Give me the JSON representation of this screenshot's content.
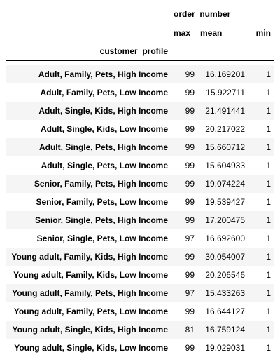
{
  "table": {
    "column_group": "order_number",
    "columns": [
      "max",
      "mean",
      "min"
    ],
    "index_name": "customer_profile",
    "rows": [
      {
        "label": "Adult, Family, Pets, High Income",
        "max": "99",
        "mean": "16.169201",
        "min": "1"
      },
      {
        "label": "Adult, Family, Pets, Low Income",
        "max": "99",
        "mean": "15.922711",
        "min": "1"
      },
      {
        "label": "Adult, Single, Kids, High Income",
        "max": "99",
        "mean": "21.491441",
        "min": "1"
      },
      {
        "label": "Adult, Single, Kids, Low Income",
        "max": "99",
        "mean": "20.217022",
        "min": "1"
      },
      {
        "label": "Adult, Single, Pets, High Income",
        "max": "99",
        "mean": "15.660712",
        "min": "1"
      },
      {
        "label": "Adult, Single, Pets, Low Income",
        "max": "99",
        "mean": "15.604933",
        "min": "1"
      },
      {
        "label": "Senior, Family, Pets, High Income",
        "max": "99",
        "mean": "19.074224",
        "min": "1"
      },
      {
        "label": "Senior, Family, Pets, Low Income",
        "max": "99",
        "mean": "19.539427",
        "min": "1"
      },
      {
        "label": "Senior, Single, Pets, High Income",
        "max": "99",
        "mean": "17.200475",
        "min": "1"
      },
      {
        "label": "Senior, Single, Pets, Low Income",
        "max": "97",
        "mean": "16.692600",
        "min": "1"
      },
      {
        "label": "Young adult, Family, Kids, High Income",
        "max": "99",
        "mean": "30.054007",
        "min": "1"
      },
      {
        "label": "Young adult, Family, Kids, Low Income",
        "max": "99",
        "mean": "20.206546",
        "min": "1"
      },
      {
        "label": "Young adult, Family, Pets, High Income",
        "max": "97",
        "mean": "15.433263",
        "min": "1"
      },
      {
        "label": "Young adult, Family, Pets, Low Income",
        "max": "99",
        "mean": "16.644127",
        "min": "1"
      },
      {
        "label": "Young adult, Single, Kids, High Income",
        "max": "81",
        "mean": "16.759124",
        "min": "1"
      },
      {
        "label": "Young adult, Single, Kids, Low Income",
        "max": "99",
        "mean": "19.029031",
        "min": "1"
      }
    ]
  },
  "colors": {
    "stripe": "#f5f5f5",
    "background": "#ffffff",
    "header_rule": "#000000",
    "text": "#000000"
  }
}
